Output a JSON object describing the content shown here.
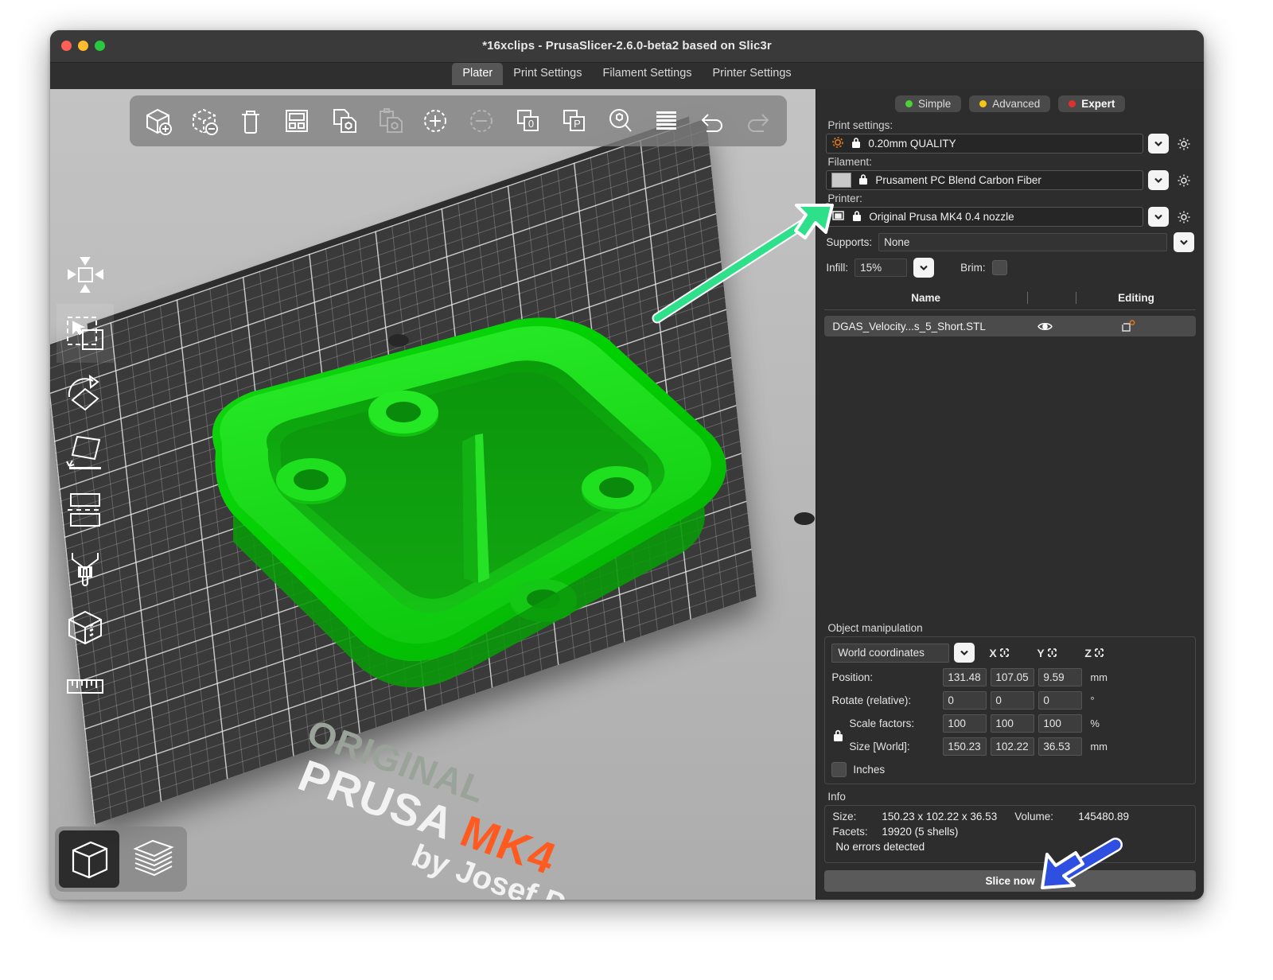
{
  "window": {
    "title": "*16xclips - PrusaSlicer-2.6.0-beta2 based on Slic3r"
  },
  "tabs": [
    {
      "label": "Plater",
      "active": true
    },
    {
      "label": "Print Settings",
      "active": false
    },
    {
      "label": "Filament Settings",
      "active": false
    },
    {
      "label": "Printer Settings",
      "active": false
    }
  ],
  "modes": [
    {
      "label": "Simple",
      "color": "#4cd137",
      "active": false
    },
    {
      "label": "Advanced",
      "color": "#f5c518",
      "active": false
    },
    {
      "label": "Expert",
      "color": "#e03131",
      "active": true
    }
  ],
  "settings": {
    "print_label": "Print settings:",
    "print_value": "0.20mm QUALITY",
    "filament_label": "Filament:",
    "filament_value": "Prusament PC Blend Carbon Fiber",
    "filament_color": "#c9c9c9",
    "printer_label": "Printer:",
    "printer_value": "Original Prusa MK4 0.4 nozzle",
    "supports_label": "Supports:",
    "supports_value": "None",
    "infill_label": "Infill:",
    "infill_value": "15%",
    "brim_label": "Brim:"
  },
  "object_list": {
    "columns": [
      "Name",
      "Editing"
    ],
    "rows": [
      {
        "name": "DGAS_Velocity...s_5_Short.STL"
      }
    ]
  },
  "object_manipulation": {
    "title": "Object manipulation",
    "coordinate_system": "World coordinates",
    "axes": [
      "X",
      "Y",
      "Z"
    ],
    "rows": [
      {
        "label": "Position:",
        "x": "131.48",
        "y": "107.05",
        "z": "9.59",
        "unit": "mm"
      },
      {
        "label": "Rotate (relative):",
        "x": "0",
        "y": "0",
        "z": "0",
        "unit": "°"
      },
      {
        "label": "Scale factors:",
        "x": "100",
        "y": "100",
        "z": "100",
        "unit": "%"
      },
      {
        "label": "Size [World]:",
        "x": "150.23",
        "y": "102.22",
        "z": "36.53",
        "unit": "mm"
      }
    ],
    "inches_label": "Inches"
  },
  "info": {
    "title": "Info",
    "size_label": "Size:",
    "size_value": "150.23 x 102.22 x 36.53",
    "volume_label": "Volume:",
    "volume_value": "145480.89",
    "facets_label": "Facets:",
    "facets_value": "19920 (5 shells)",
    "errors": "No errors detected"
  },
  "slice_button": "Slice now",
  "bed": {
    "line1": "ORIGINAL",
    "line2": "PRUSA",
    "line2_accent": "MK4",
    "line3": "by Josef Prusa",
    "accent_color": "#ff5a1f"
  },
  "top_toolbar": [
    {
      "name": "add-object-icon",
      "enabled": true
    },
    {
      "name": "delete-object-icon",
      "enabled": true
    },
    {
      "name": "delete-all-icon",
      "enabled": true
    },
    {
      "name": "arrange-icon",
      "enabled": true
    },
    {
      "name": "copy-icon",
      "enabled": true
    },
    {
      "name": "paste-icon",
      "enabled": false
    },
    {
      "name": "add-instance-icon",
      "enabled": true
    },
    {
      "name": "remove-instance-icon",
      "enabled": false
    },
    {
      "name": "split-to-objects-icon",
      "enabled": true
    },
    {
      "name": "split-to-parts-icon",
      "enabled": true
    },
    {
      "name": "search-icon",
      "enabled": true
    },
    {
      "name": "variable-layer-height-icon",
      "enabled": true
    },
    {
      "name": "undo-icon",
      "enabled": true
    },
    {
      "name": "redo-icon",
      "enabled": false
    }
  ],
  "left_toolbar": [
    {
      "name": "move-gizmo-icon",
      "selected": false
    },
    {
      "name": "scale-gizmo-icon",
      "selected": true
    },
    {
      "name": "rotate-gizmo-icon",
      "selected": false
    },
    {
      "name": "place-on-face-gizmo-icon",
      "selected": false
    },
    {
      "name": "cut-gizmo-icon",
      "selected": false
    },
    {
      "name": "paint-support-gizmo-icon",
      "selected": false
    },
    {
      "name": "seam-gizmo-icon",
      "selected": false
    },
    {
      "name": "measure-gizmo-icon",
      "selected": false
    }
  ],
  "view_switch": [
    {
      "name": "editor-view-icon",
      "selected": true
    },
    {
      "name": "preview-view-icon",
      "selected": false
    }
  ],
  "annotations": {
    "green_arrow_color": "#2ee08a",
    "blue_arrow_color": "#2f4fe0"
  }
}
